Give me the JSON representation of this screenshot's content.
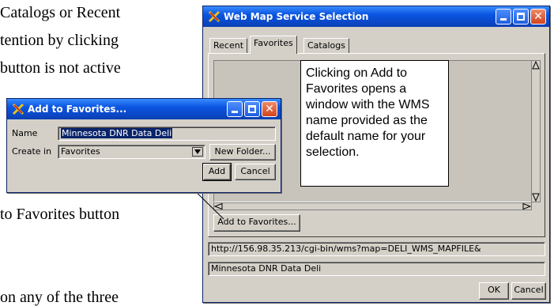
{
  "document": {
    "lines": [
      "Catalogs or Recent",
      "tention by clicking",
      "button is not active",
      "to Favorites button",
      "on any of the three"
    ]
  },
  "wms_window": {
    "title": "Web Map Service Selection",
    "tabs": [
      "Recent",
      "Favorites",
      "Catalogs"
    ],
    "active_tab": "Favorites",
    "callout_text": "Clicking on Add to Favorites opens a window with the WMS name provided as the default name for your selection.",
    "add_to_favorites_label": "Add to Favorites...",
    "url_value": "http://156.98.35.213/cgi-bin/wms?map=DELI_WMS_MAPFILE&",
    "name_value": "Minnesota DNR Data Deli",
    "ok_label": "OK",
    "cancel_label": "Cancel"
  },
  "add_window": {
    "title": "Add to Favorites...",
    "name_label": "Name",
    "name_value": "Minnesota DNR Data Deli",
    "create_in_label": "Create in",
    "create_in_value": "Favorites",
    "new_folder_label": "New Folder...",
    "add_label": "Add",
    "cancel_label": "Cancel"
  },
  "colors": {
    "titlebar_blue": "#0a55e0",
    "window_face": "#d4d0c8",
    "close_red": "#d1431c"
  },
  "icons": [
    "app-icon",
    "minimize-icon",
    "maximize-icon",
    "close-icon",
    "dropdown-arrow-icon",
    "scroll-up-arrow-icon",
    "scroll-down-arrow-icon",
    "scroll-left-arrow-icon",
    "scroll-right-arrow-icon"
  ]
}
